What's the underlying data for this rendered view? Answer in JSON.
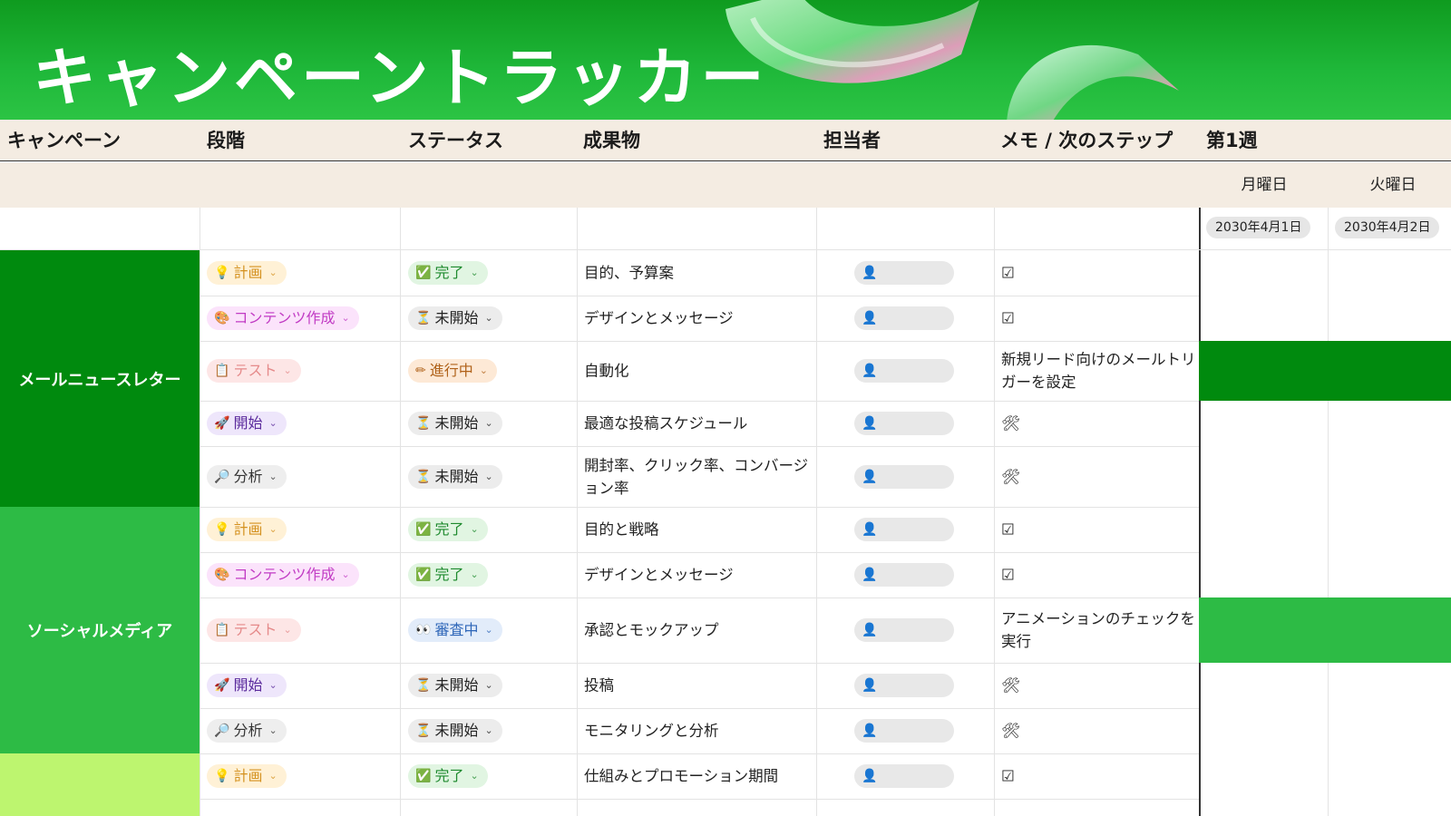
{
  "title": "キャンペーントラッカー",
  "headers": {
    "campaign": "キャンペーン",
    "stage": "段階",
    "status": "ステータス",
    "deliverable": "成果物",
    "owner": "担当者",
    "memo": "メモ / 次のステップ",
    "week": "第1週"
  },
  "days": [
    {
      "name": "月曜日",
      "date": "2030年4月1日"
    },
    {
      "name": "火曜日",
      "date": "2030年4月2日"
    }
  ],
  "colors": {
    "email": "#008a0e",
    "social": "#2dbb45",
    "third": "#bdf56f",
    "gantt_email": "#008a0e",
    "gantt_social": "#2dbb45"
  },
  "campaigns": [
    {
      "name": "メールニュースレター"
    },
    {
      "name": "ソーシャルメディア"
    },
    {
      "name": ""
    }
  ],
  "rows": [
    {
      "stage_icon": "💡",
      "stage": "計画",
      "status_icon": "✅",
      "status": "完了",
      "deliverable": "目的、予算案",
      "owner_icon": "👤",
      "memo": "☑"
    },
    {
      "stage_icon": "🎨",
      "stage": "コンテンツ作成",
      "status_icon": "⏳",
      "status": "未開始",
      "deliverable": "デザインとメッセージ",
      "owner_icon": "👤",
      "memo": "☑"
    },
    {
      "stage_icon": "📋",
      "stage": "テスト",
      "status_icon": "✏",
      "status": "進行中",
      "deliverable": "自動化",
      "owner_icon": "👤",
      "memo": "新規リード向けのメールトリガーを設定"
    },
    {
      "stage_icon": "🚀",
      "stage": "開始",
      "status_icon": "⏳",
      "status": "未開始",
      "deliverable": "最適な投稿スケジュール",
      "owner_icon": "👤",
      "memo": "🛠"
    },
    {
      "stage_icon": "🔎",
      "stage": "分析",
      "status_icon": "⏳",
      "status": "未開始",
      "deliverable": "開封率、クリック率、コンバージョン率",
      "owner_icon": "👤",
      "memo": "🛠"
    },
    {
      "stage_icon": "💡",
      "stage": "計画",
      "status_icon": "✅",
      "status": "完了",
      "deliverable": "目的と戦略",
      "owner_icon": "👤",
      "memo": "☑"
    },
    {
      "stage_icon": "🎨",
      "stage": "コンテンツ作成",
      "status_icon": "✅",
      "status": "完了",
      "deliverable": "デザインとメッセージ",
      "owner_icon": "👤",
      "memo": "☑"
    },
    {
      "stage_icon": "📋",
      "stage": "テスト",
      "status_icon": "👀",
      "status": "審査中",
      "deliverable": "承認とモックアップ",
      "owner_icon": "👤",
      "memo": "アニメーションのチェックを実行"
    },
    {
      "stage_icon": "🚀",
      "stage": "開始",
      "status_icon": "⏳",
      "status": "未開始",
      "deliverable": "投稿",
      "owner_icon": "👤",
      "memo": "🛠"
    },
    {
      "stage_icon": "🔎",
      "stage": "分析",
      "status_icon": "⏳",
      "status": "未開始",
      "deliverable": "モニタリングと分析",
      "owner_icon": "👤",
      "memo": "🛠"
    },
    {
      "stage_icon": "💡",
      "stage": "計画",
      "status_icon": "✅",
      "status": "完了",
      "deliverable": "仕組みとプロモーション期間",
      "owner_icon": "👤",
      "memo": "☑"
    }
  ]
}
